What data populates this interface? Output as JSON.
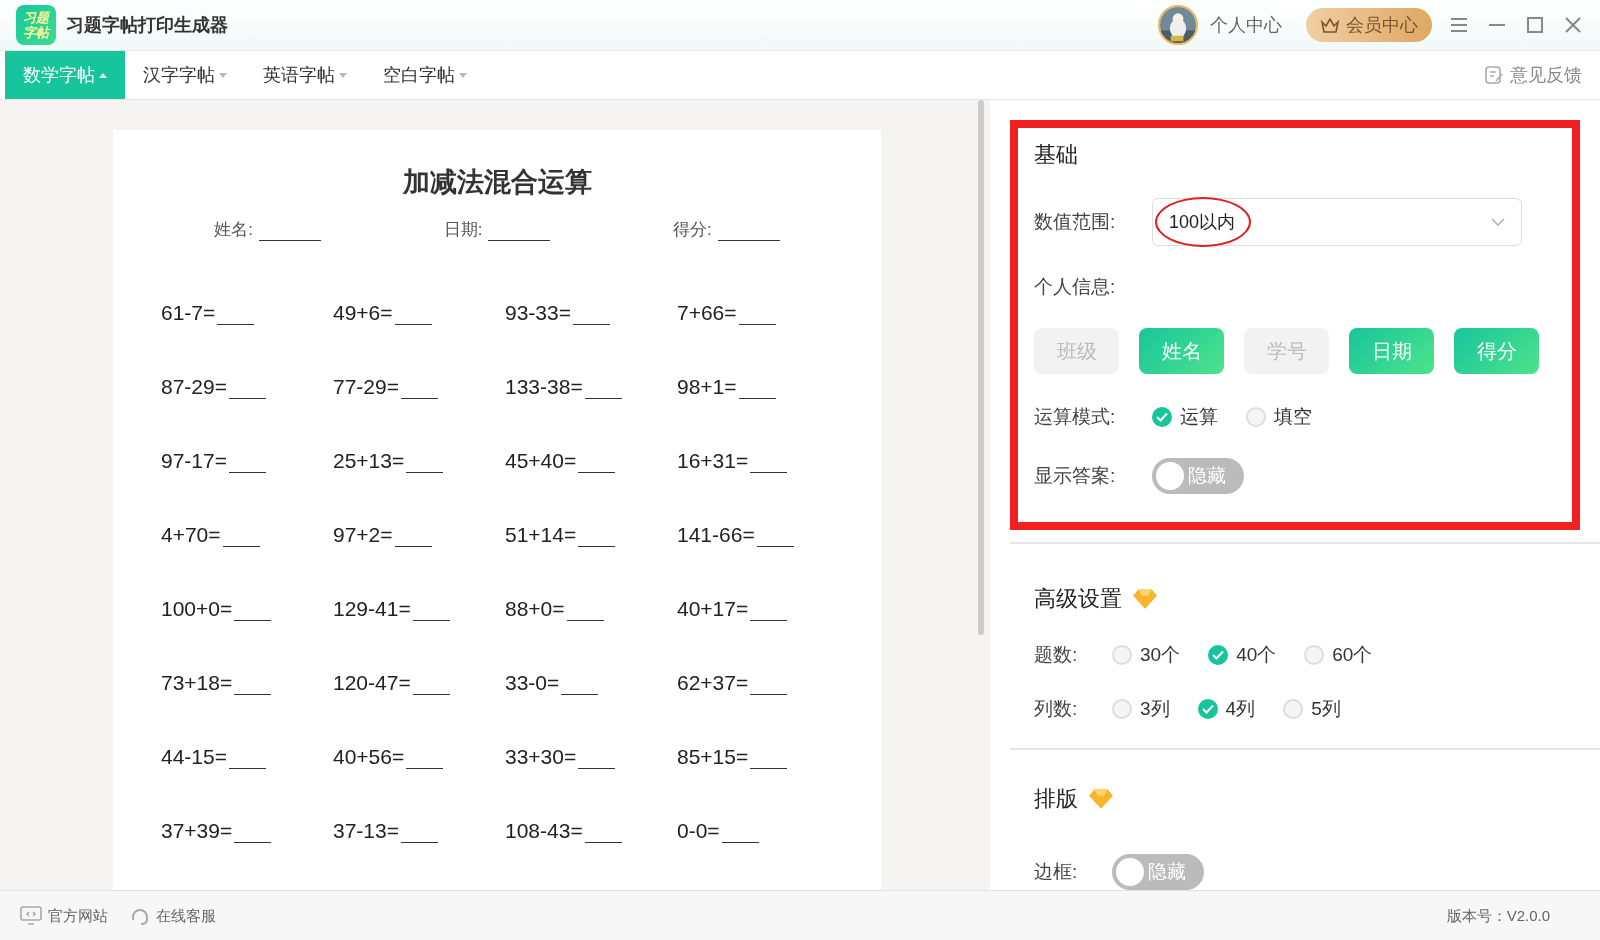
{
  "window": {
    "logo": "习题字帖",
    "title": "习题字帖打印生成器",
    "user": "个人中心",
    "vip": "会员中心"
  },
  "tabs": [
    {
      "label": "数学字帖",
      "selected": true
    },
    {
      "label": "汉字字帖",
      "selected": false
    },
    {
      "label": "英语字帖",
      "selected": false
    },
    {
      "label": "空白字帖",
      "selected": false
    }
  ],
  "feedback": "意见反馈",
  "sheet": {
    "title": "加减法混合运算",
    "fields": [
      "姓名:",
      "日期:",
      "得分:"
    ],
    "problems": [
      "61-7=",
      "49+6=",
      "93-33=",
      "7+66=",
      "87-29=",
      "77-29=",
      "133-38=",
      "98+1=",
      "97-17=",
      "25+13=",
      "45+40=",
      "16+31=",
      "4+70=",
      "97+2=",
      "51+14=",
      "141-66=",
      "100+0=",
      "129-41=",
      "88+0=",
      "40+17=",
      "73+18=",
      "120-47=",
      "33-0=",
      "62+37=",
      "44-15=",
      "40+56=",
      "33+30=",
      "85+15=",
      "37+39=",
      "37-13=",
      "108-43=",
      "0-0="
    ]
  },
  "basic": {
    "title": "基础",
    "range_label": "数值范围:",
    "range_value": "100以内",
    "info_label": "个人信息:",
    "info_buttons": [
      {
        "label": "班级",
        "selected": false
      },
      {
        "label": "姓名",
        "selected": true
      },
      {
        "label": "学号",
        "selected": false
      },
      {
        "label": "日期",
        "selected": true
      },
      {
        "label": "得分",
        "selected": true
      }
    ],
    "mode_label": "运算模式:",
    "modes": [
      {
        "label": "运算",
        "selected": true
      },
      {
        "label": "填空",
        "selected": false
      }
    ],
    "answer_label": "显示答案:",
    "answer_toggle": {
      "label": "隐藏",
      "on": false
    }
  },
  "advanced": {
    "title": "高级设置",
    "count_label": "题数:",
    "counts": [
      {
        "label": "30个",
        "selected": false
      },
      {
        "label": "40个",
        "selected": true
      },
      {
        "label": "60个",
        "selected": false
      }
    ],
    "cols_label": "列数:",
    "cols": [
      {
        "label": "3列",
        "selected": false
      },
      {
        "label": "4列",
        "selected": true
      },
      {
        "label": "5列",
        "selected": false
      }
    ]
  },
  "layout": {
    "title": "排版",
    "border_label": "边框:",
    "border_toggle": {
      "label": "隐藏",
      "on": false
    }
  },
  "status_bar": {
    "links": [
      "官方网站",
      "在线客服"
    ],
    "version": "版本号：V2.0.0"
  }
}
